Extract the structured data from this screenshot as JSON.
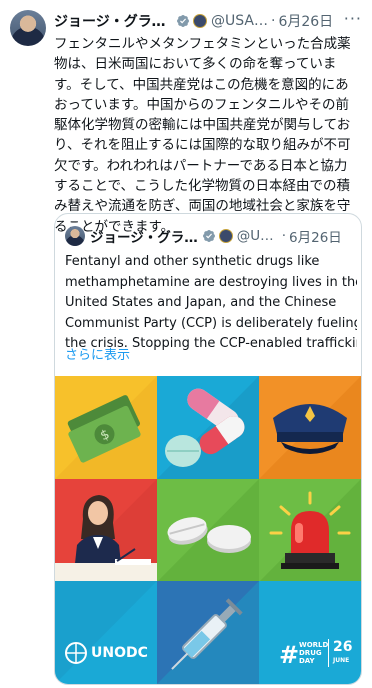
{
  "tweet": {
    "display_name": "ジョージ・グラス…",
    "handle": "@USA…",
    "dot": "·",
    "date": "6月26日",
    "more": "···",
    "text": "フェンタニルやメタンフェタミンといった合成薬物は、日米両国において多くの命を奪っています。そして、中国共産党はこの危機を意図的にあおっています。中国からのフェンタニルやその前駆体化学物質の密輸には中国共産党が関与しており、それを阻止するには国際的な取り組みが不可欠です。われわれはパートナーである日本と協力することで、こうした化学物質の日本経由での積み替えや流通を防ぎ、両国の地域社会と家族を守ることができます。"
  },
  "quote": {
    "display_name": "ジョージ・グラ…",
    "handle": "@US…",
    "dot": "·",
    "date": "6月26日",
    "lines": [
      "Fentanyl and other synthetic drugs like",
      "methamphetamine are destroying lives in the",
      "United States and Japan, and the Chinese",
      "Communist Party (CCP) is deliberately fueling",
      "the crisis. Stopping the CCP-enabled trafficking…"
    ],
    "show_more": "さらに表示"
  },
  "image": {
    "unodc_label": "UNODC",
    "wdd_lines": [
      "WORLD",
      "DRUG",
      "DAY"
    ],
    "wdd_date": "26",
    "wdd_month": "JUNE",
    "colors": {
      "yellow": "#f7c12b",
      "cyan": "#1aa9d6",
      "orange": "#f29127",
      "red": "#e6433b",
      "green": "#6dbd45",
      "blue": "#2c74b5",
      "link": "#1d9bf0"
    }
  }
}
